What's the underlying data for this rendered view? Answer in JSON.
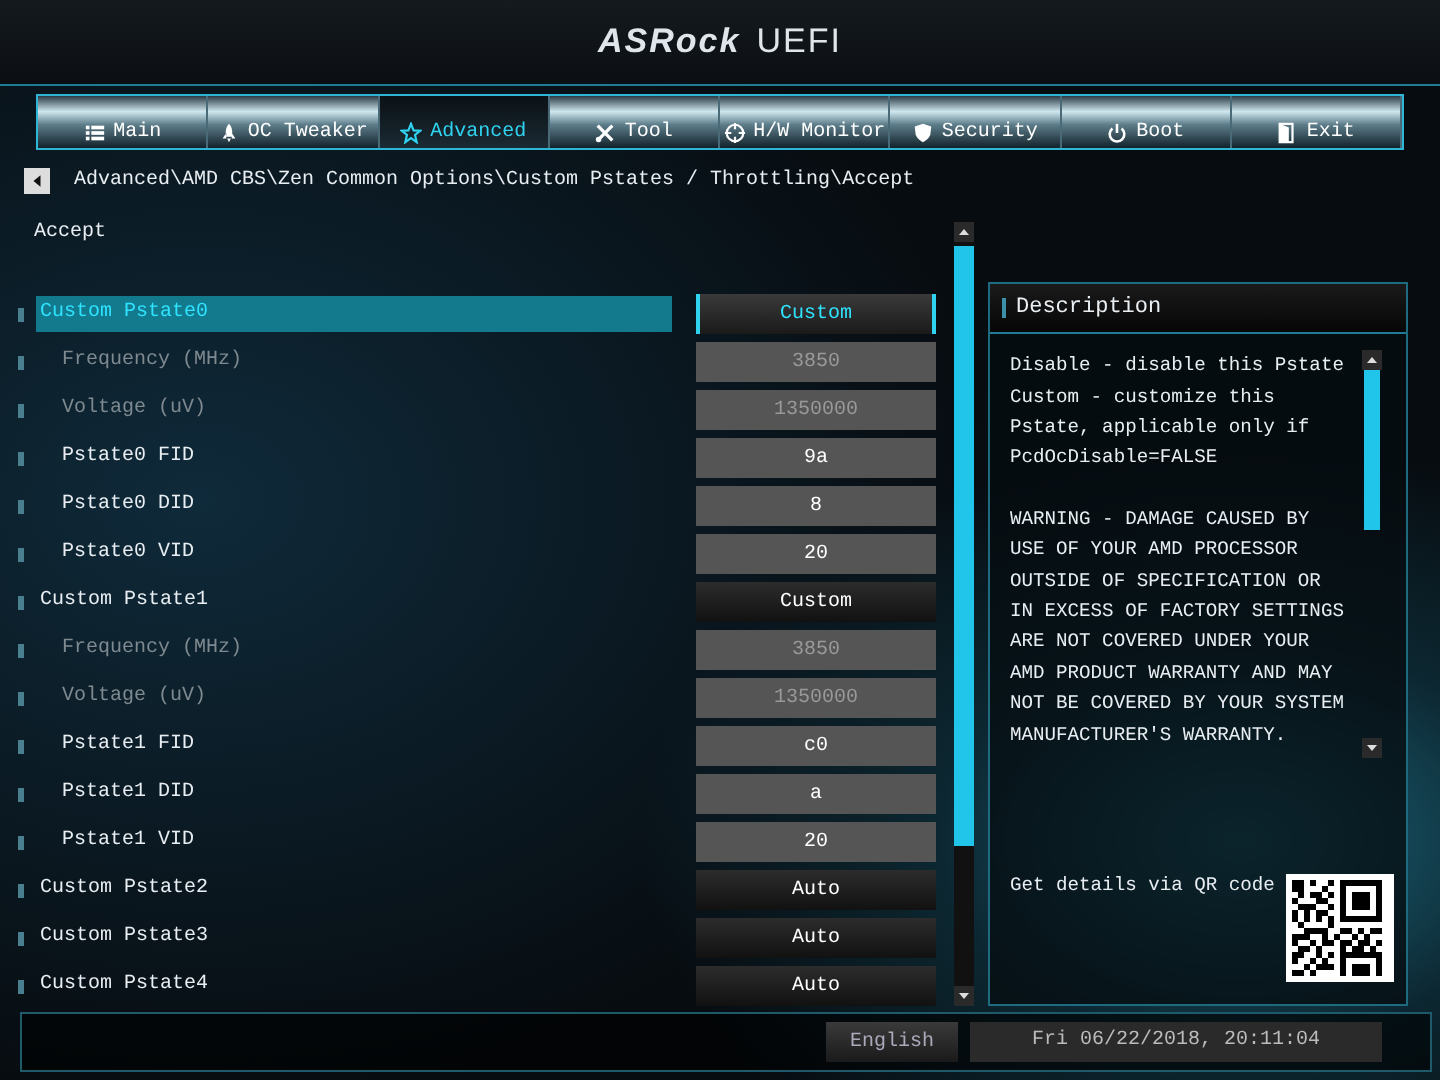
{
  "logo": {
    "brand": "ASRock",
    "product": "UEFI"
  },
  "tabs": [
    {
      "label": "Main",
      "kind": "list",
      "selected": false
    },
    {
      "label": "OC Tweaker",
      "kind": "rocket",
      "selected": false
    },
    {
      "label": "Advanced",
      "kind": "star",
      "selected": true
    },
    {
      "label": "Tool",
      "kind": "tools",
      "selected": false
    },
    {
      "label": "H/W Monitor",
      "kind": "crosshair",
      "selected": false
    },
    {
      "label": "Security",
      "kind": "shield",
      "selected": false
    },
    {
      "label": "Boot",
      "kind": "power",
      "selected": false
    },
    {
      "label": "Exit",
      "kind": "door",
      "selected": false
    }
  ],
  "breadcrumb": "Advanced\\AMD CBS\\Zen Common Options\\Custom Pstates / Throttling\\Accept",
  "page_title": "Accept",
  "settings": [
    {
      "label": "Custom Pstate0",
      "value": "Custom",
      "kind": "option",
      "selected": true,
      "children": [
        {
          "label": "Frequency (MHz)",
          "value": "3850",
          "kind": "number",
          "disabled": true,
          "selected": false
        },
        {
          "label": "Voltage (uV)",
          "value": "1350000",
          "kind": "number",
          "disabled": true,
          "selected": false
        },
        {
          "label": "Pstate0 FID",
          "value": "9a",
          "kind": "number",
          "disabled": false,
          "selected": false
        },
        {
          "label": "Pstate0 DID",
          "value": "8",
          "kind": "number",
          "disabled": false,
          "selected": false
        },
        {
          "label": "Pstate0 VID",
          "value": "20",
          "kind": "number",
          "disabled": false,
          "selected": false
        }
      ]
    },
    {
      "label": "Custom Pstate1",
      "value": "Custom",
      "kind": "option",
      "selected": false,
      "children": [
        {
          "label": "Frequency (MHz)",
          "value": "3850",
          "kind": "number",
          "disabled": true,
          "selected": false
        },
        {
          "label": "Voltage (uV)",
          "value": "1350000",
          "kind": "number",
          "disabled": true,
          "selected": false
        },
        {
          "label": "Pstate1 FID",
          "value": "c0",
          "kind": "number",
          "disabled": false,
          "selected": false
        },
        {
          "label": "Pstate1 DID",
          "value": "a",
          "kind": "number",
          "disabled": false,
          "selected": false
        },
        {
          "label": "Pstate1 VID",
          "value": "20",
          "kind": "number",
          "disabled": false,
          "selected": false
        }
      ]
    },
    {
      "label": "Custom Pstate2",
      "value": "Auto",
      "kind": "option",
      "selected": false
    },
    {
      "label": "Custom Pstate3",
      "value": "Auto",
      "kind": "option",
      "selected": false
    },
    {
      "label": "Custom Pstate4",
      "value": "Auto",
      "kind": "option",
      "selected": false
    }
  ],
  "description": {
    "title": "Description",
    "paragraphs": [
      "Disable - disable this Pstate Custom - customize this Pstate, applicable only if PcdOcDisable=FALSE",
      "WARNING - DAMAGE CAUSED BY USE OF YOUR AMD PROCESSOR OUTSIDE OF SPECIFICATION OR IN EXCESS OF FACTORY SETTINGS ARE NOT COVERED UNDER YOUR AMD PRODUCT WARRANTY AND MAY NOT BE COVERED BY YOUR SYSTEM MANUFACTURER'S WARRANTY."
    ],
    "qr_hint": "Get details via QR code"
  },
  "status_bar": {
    "language": "English",
    "datetime": "Fri 06/22/2018, 20:11:04"
  }
}
